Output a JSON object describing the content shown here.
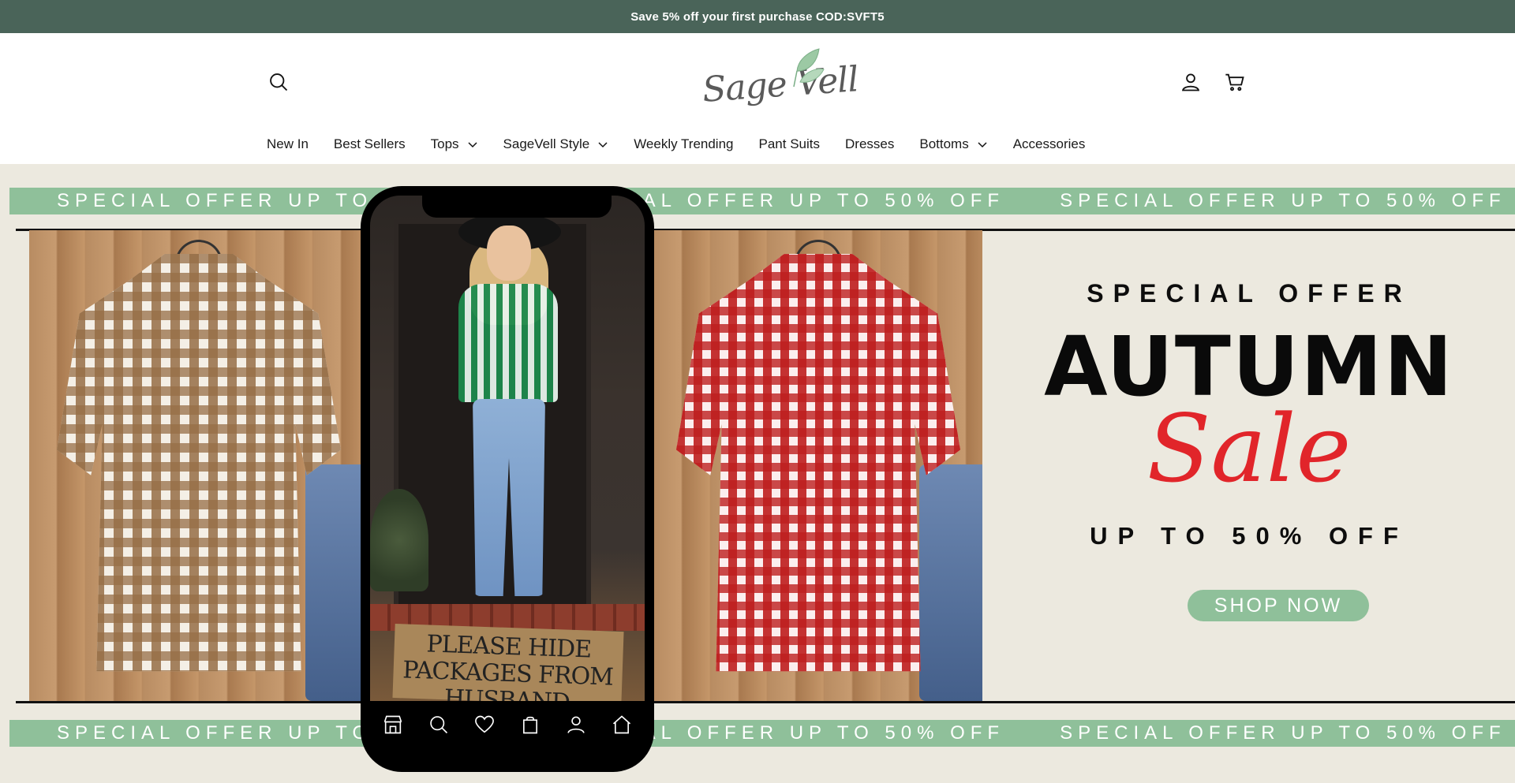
{
  "announcement": {
    "text": "Save 5% off your first purchase COD:SVFT5"
  },
  "header": {
    "logo_text": "Sage Vell",
    "icons": {
      "search": "search-icon",
      "account": "user-icon",
      "cart": "cart-icon"
    }
  },
  "nav": {
    "items": [
      {
        "label": "New In",
        "dropdown": false
      },
      {
        "label": "Best Sellers",
        "dropdown": false
      },
      {
        "label": "Tops",
        "dropdown": true
      },
      {
        "label": "SageVell Style",
        "dropdown": true
      },
      {
        "label": "Weekly Trending",
        "dropdown": false
      },
      {
        "label": "Pant Suits",
        "dropdown": false
      },
      {
        "label": "Dresses",
        "dropdown": false
      },
      {
        "label": "Bottoms",
        "dropdown": true
      },
      {
        "label": "Accessories",
        "dropdown": false
      }
    ]
  },
  "hero": {
    "ticker_text": "SPECIAL OFFER UP TO 50% OFF",
    "doormat_text": "PLEASE HIDE PACKAGES FROM HUSBAND",
    "offer": {
      "kicker": "SPECIAL OFFER",
      "title": "AUTUMN",
      "script": "Sale",
      "subtitle": "UP TO 50% OFF",
      "cta": "SHOP NOW"
    },
    "phone_nav_icons": [
      "store-icon",
      "search-icon",
      "heart-icon",
      "bag-icon",
      "user-icon",
      "home-icon"
    ]
  },
  "colors": {
    "announcement_bg": "#4a6459",
    "hero_bg": "#ece9df",
    "accent_green": "#8fc09a",
    "sale_red": "#e1252a"
  }
}
